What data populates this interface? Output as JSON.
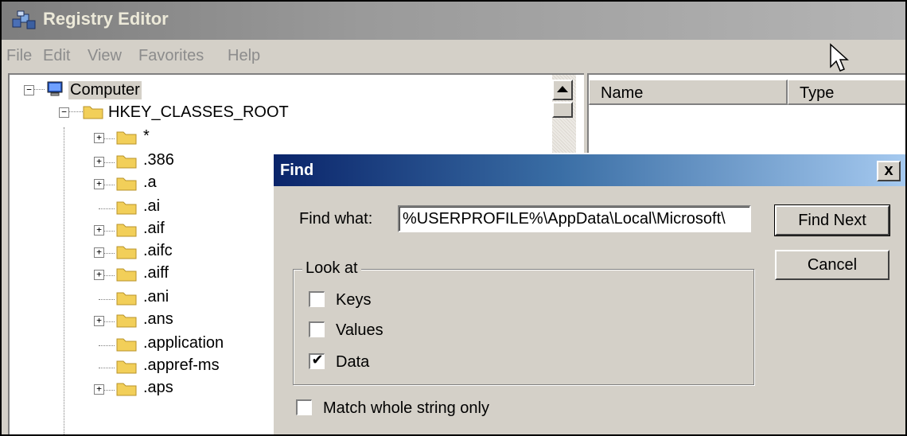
{
  "window": {
    "title": "Registry Editor"
  },
  "menu": [
    "File",
    "Edit",
    "View",
    "Favorites",
    "Help"
  ],
  "tree": {
    "root": "Computer",
    "hive": "HKEY_CLASSES_ROOT",
    "items": [
      "*",
      ".386",
      ".a",
      ".ai",
      ".aif",
      ".aifc",
      ".aiff",
      ".ani",
      ".ans",
      ".application",
      ".appref-ms",
      ".aps"
    ]
  },
  "list": {
    "columns": [
      "Name",
      "Type"
    ]
  },
  "find_dialog": {
    "title": "Find",
    "close_label": "x",
    "find_what_label": "Find what:",
    "find_what_value": "%USERPROFILE%\\AppData\\Local\\Microsoft\\",
    "find_next_label": "Find Next",
    "cancel_label": "Cancel",
    "look_at_label": "Look at",
    "checkboxes": [
      {
        "label": "Keys",
        "checked": false
      },
      {
        "label": "Values",
        "checked": false
      },
      {
        "label": "Data",
        "checked": true
      }
    ],
    "match_whole_label": "Match whole string only",
    "match_whole_checked": false
  }
}
